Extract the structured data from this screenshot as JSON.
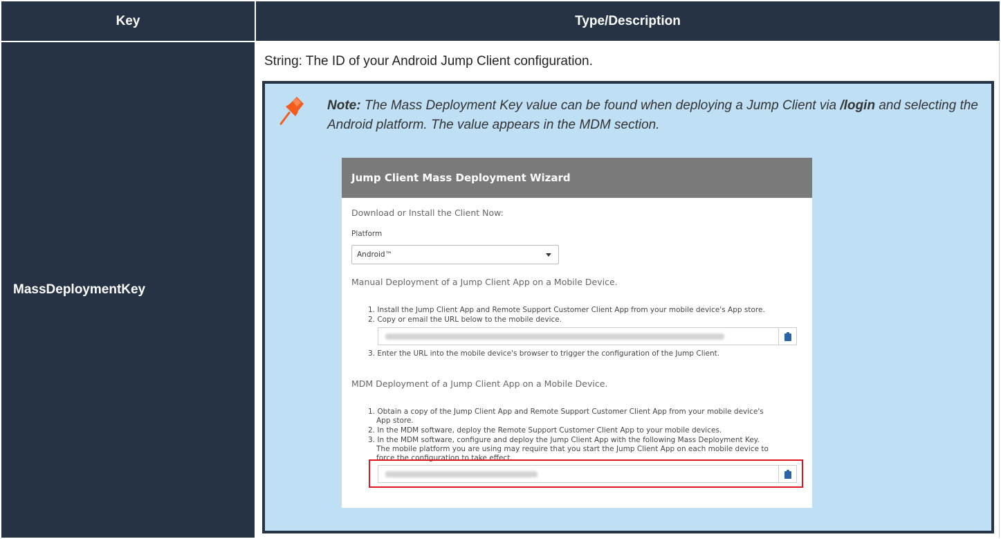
{
  "table": {
    "header_key": "Key",
    "header_desc": "Type/Description",
    "key_name": "MassDeploymentKey",
    "description": "String: The ID of your Android Jump Client configuration."
  },
  "note": {
    "label": "Note:",
    "text_before": " The Mass Deployment Key value can be found when deploying a Jump Client via ",
    "path": "/login",
    "text_after": " and selecting the Android platform. The value appears in the MDM section.",
    "icon": "pushpin-icon",
    "colors": {
      "background": "#bfdff5",
      "border": "#253345",
      "pin": "#f25c1d"
    }
  },
  "wizard": {
    "title": "Jump Client Mass Deployment Wizard",
    "download_title": "Download or Install the Client Now:",
    "platform_label": "Platform",
    "platform_value": "Android™",
    "manual_title": "Manual Deployment of a Jump Client App on a Mobile Device.",
    "manual_steps": [
      "1. Install the Jump Client App and Remote Support Customer Client App from your mobile device's App store.",
      "2. Copy or email the URL below to the mobile device.",
      "3. Enter the URL into the mobile device's browser to trigger the configuration of the Jump Client."
    ],
    "mdm_title": "MDM Deployment of a Jump Client App on a Mobile Device.",
    "mdm_steps": [
      "1. Obtain a copy of the Jump Client App and Remote Support Customer Client App from your mobile device's",
      "App store.",
      "2. In the MDM software, deploy the Remote Support Customer Client App to your mobile devices.",
      "3. In the MDM software, configure and deploy the Jump Client App with the following Mass Deployment Key.",
      "The mobile platform you are using may require that you start the Jump Client App on each mobile device to",
      "force the configuration to take effect."
    ],
    "copy_icon": "clipboard-icon",
    "colors": {
      "titlebar": "#7a7a7a",
      "clipboard": "#2a63a8",
      "highlight": "#e0141e"
    }
  }
}
